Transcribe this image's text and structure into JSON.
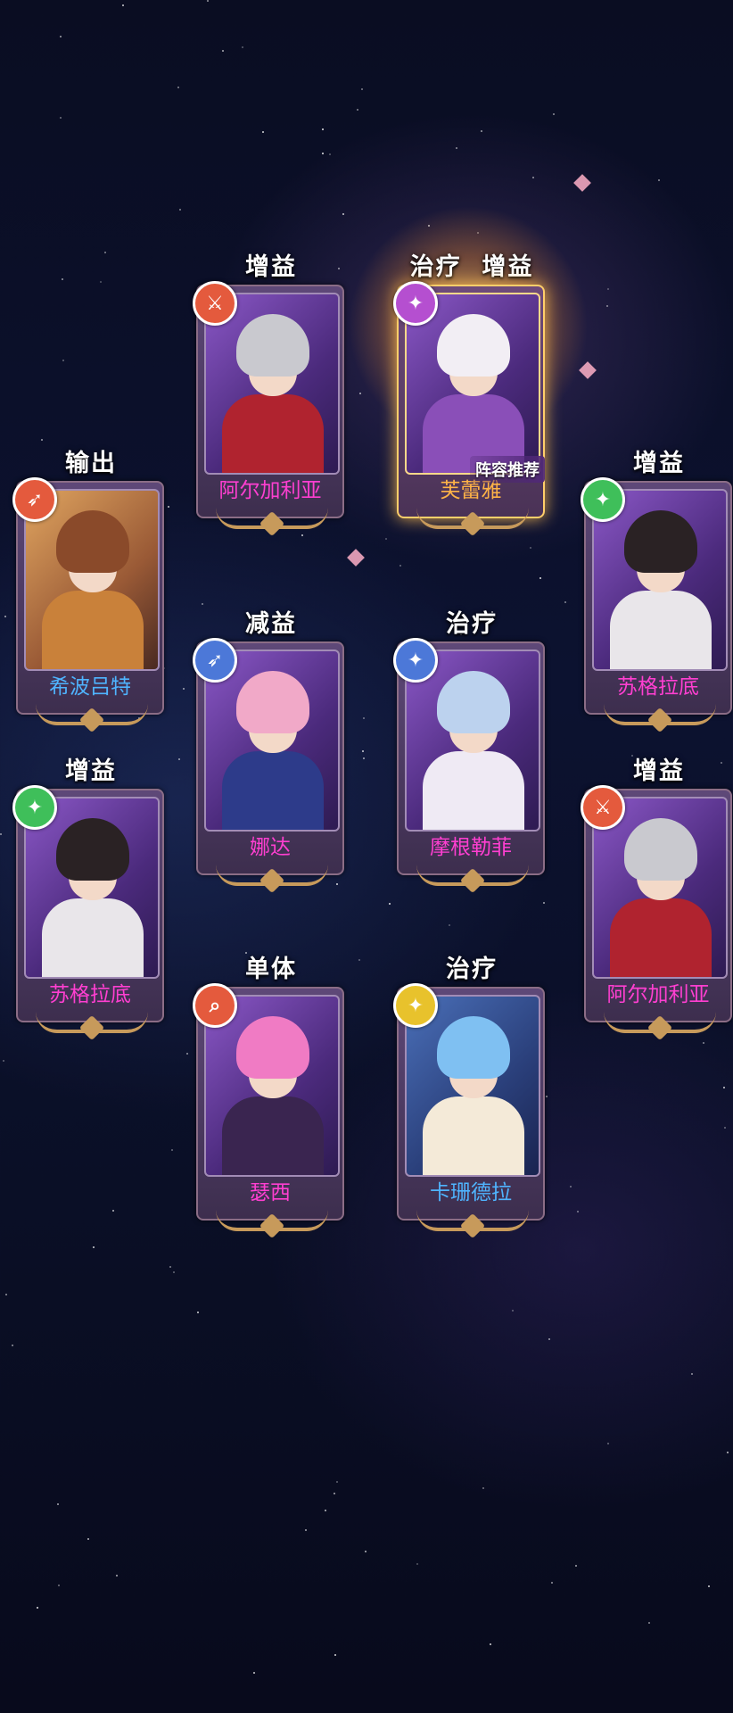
{
  "featured": {
    "recommend_label": "阵容推荐"
  },
  "cards": [
    {
      "id": "c1",
      "role": "增益",
      "name": "阿尔加利亚",
      "name_color": "pink",
      "badge": "sword-icon",
      "badge_color": "red",
      "hair": "#c9c9cf",
      "outfit": "#b0232f"
    },
    {
      "id": "c2",
      "role": "治疗  增益",
      "name": "芙蕾雅",
      "name_color": "gold",
      "badge": "wings-icon",
      "badge_color": "purple",
      "hair": "#f2eef4",
      "outfit": "#8a4fb8"
    },
    {
      "id": "c3",
      "role": "输出",
      "name": "希波吕特",
      "name_color": "blue",
      "badge": "bow-icon",
      "badge_color": "red",
      "hair": "#8a4a2a",
      "outfit": "#c9813a"
    },
    {
      "id": "c4",
      "role": "增益",
      "name": "苏格拉底",
      "name_color": "pink",
      "badge": "wings-icon",
      "badge_color": "green",
      "hair": "#2a2224",
      "outfit": "#e9e6ea"
    },
    {
      "id": "c5",
      "role": "减益",
      "name": "娜达",
      "name_color": "pink",
      "badge": "bow-icon",
      "badge_color": "blue",
      "hair": "#f1a9c8",
      "outfit": "#2d3b8a"
    },
    {
      "id": "c6",
      "role": "治疗",
      "name": "摩根勒菲",
      "name_color": "pink",
      "badge": "wings-icon",
      "badge_color": "blue",
      "hair": "#bcd2ee",
      "outfit": "#efeaf4"
    },
    {
      "id": "c7",
      "role": "增益",
      "name": "苏格拉底",
      "name_color": "pink",
      "badge": "wings-icon",
      "badge_color": "green",
      "hair": "#2a2224",
      "outfit": "#e9e6ea"
    },
    {
      "id": "c8",
      "role": "增益",
      "name": "阿尔加利亚",
      "name_color": "pink",
      "badge": "sword-icon",
      "badge_color": "red",
      "hair": "#c9c9cf",
      "outfit": "#b0232f"
    },
    {
      "id": "c9",
      "role": "单体",
      "name": "瑟西",
      "name_color": "pink",
      "badge": "magnifier-icon",
      "badge_color": "red",
      "hair": "#f07bc4",
      "outfit": "#3a2550"
    },
    {
      "id": "c10",
      "role": "治疗",
      "name": "卡珊德拉",
      "name_color": "blue",
      "badge": "wings-icon",
      "badge_color": "yellow",
      "hair": "#7fc0f2",
      "outfit": "#f4ead8"
    }
  ]
}
